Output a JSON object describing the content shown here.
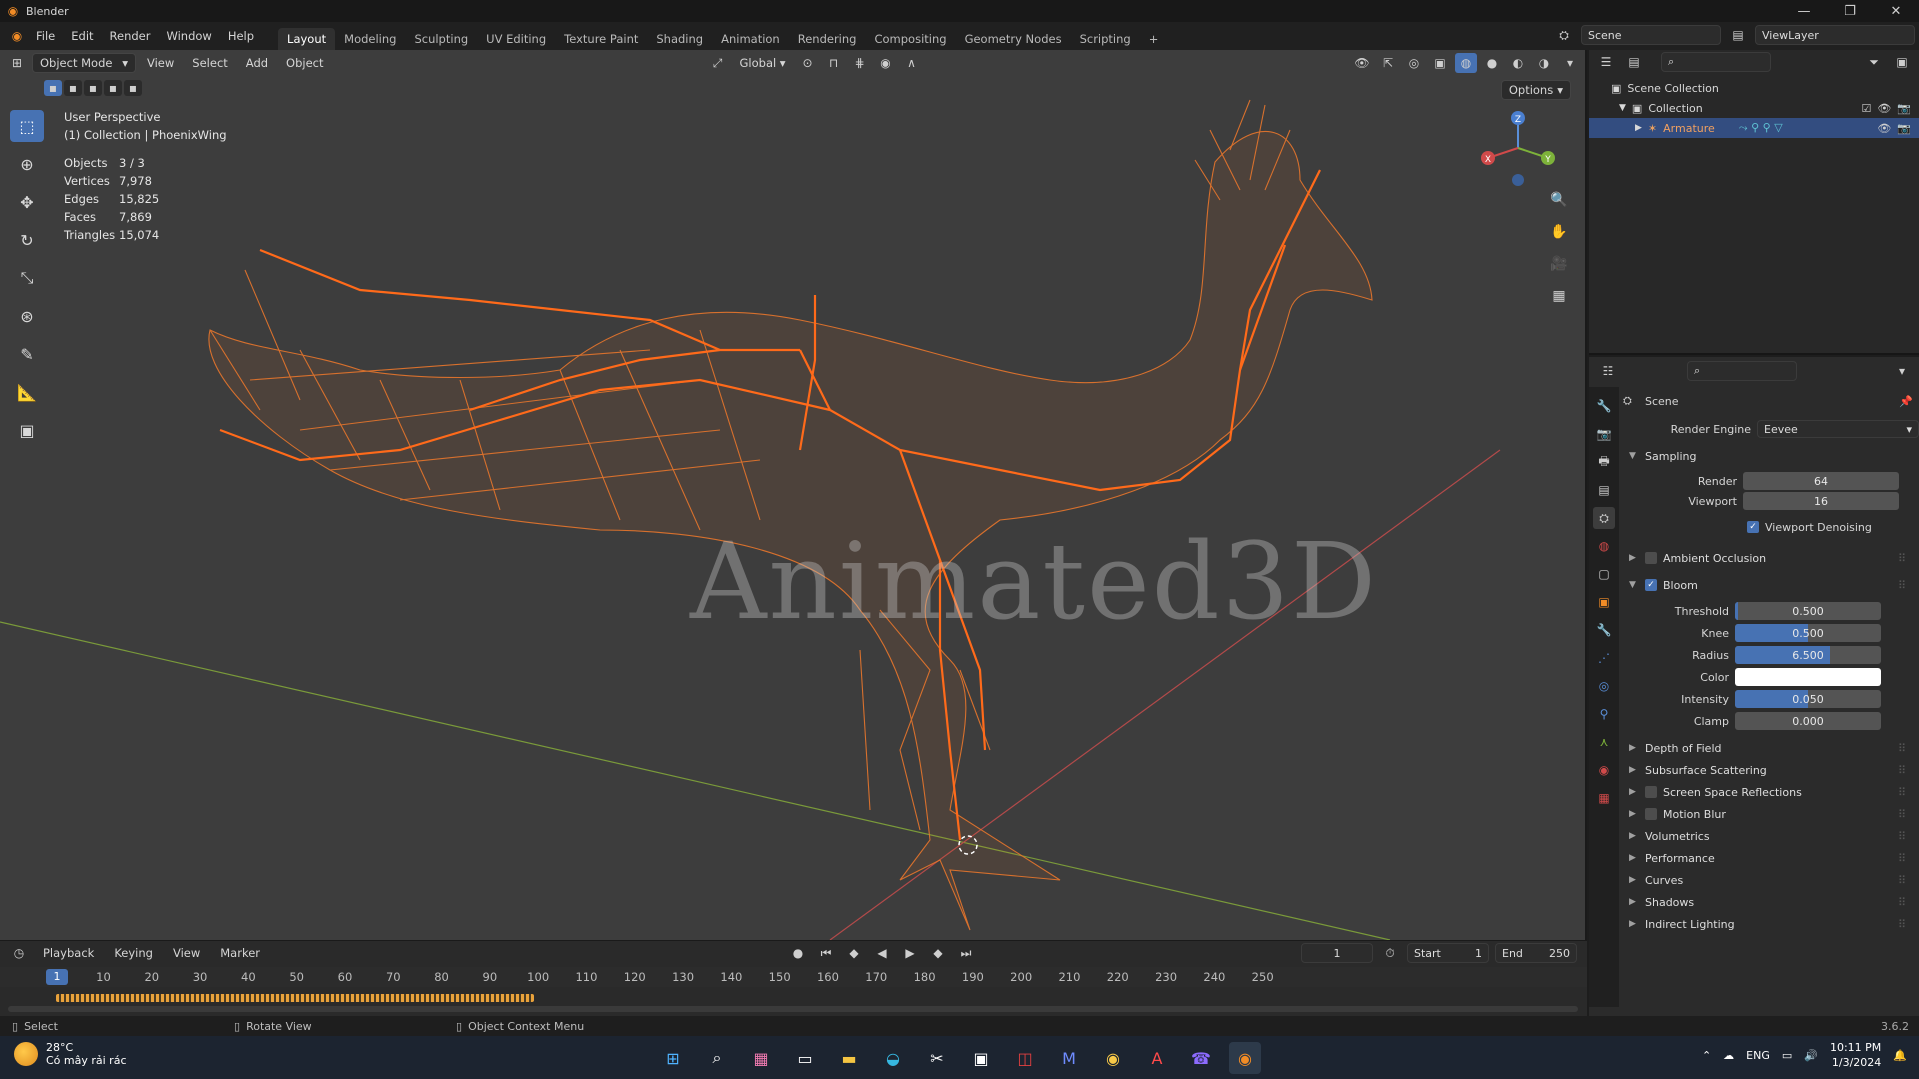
{
  "window": {
    "title": "Blender",
    "controls": [
      "—",
      "❐",
      "✕"
    ]
  },
  "menu": {
    "items": [
      "File",
      "Edit",
      "Render",
      "Window",
      "Help"
    ]
  },
  "workspaces": {
    "tabs": [
      "Layout",
      "Modeling",
      "Sculpting",
      "UV Editing",
      "Texture Paint",
      "Shading",
      "Animation",
      "Rendering",
      "Compositing",
      "Geometry Nodes",
      "Scripting"
    ],
    "active": "Layout",
    "add": "+"
  },
  "scene_selector": {
    "value": "Scene"
  },
  "viewlayer_selector": {
    "value": "ViewLayer"
  },
  "viewport_header": {
    "mode": "Object Mode",
    "menus": [
      "View",
      "Select",
      "Add",
      "Object"
    ],
    "transform_orientation": "Global",
    "options_label": "Options"
  },
  "viewport_overlay": {
    "perspective": "User Perspective",
    "collection": "(1) Collection | PhoenixWing"
  },
  "stats": [
    {
      "label": "Objects",
      "value": "3 / 3"
    },
    {
      "label": "Vertices",
      "value": "7,978"
    },
    {
      "label": "Edges",
      "value": "15,825"
    },
    {
      "label": "Faces",
      "value": "7,869"
    },
    {
      "label": "Triangles",
      "value": "15,074"
    }
  ],
  "gizmo": {
    "x": "X",
    "y": "Y",
    "z": "Z"
  },
  "watermark": "Animated3D",
  "timeline": {
    "menus": [
      "Playback",
      "Keying",
      "View",
      "Marker"
    ],
    "current_frame": "1",
    "start_label": "Start",
    "start": "1",
    "end_label": "End",
    "end": "250",
    "ticks": [
      "10",
      "20",
      "30",
      "40",
      "50",
      "60",
      "70",
      "80",
      "90",
      "100",
      "110",
      "120",
      "130",
      "140",
      "150",
      "160",
      "170",
      "180",
      "190",
      "200",
      "210",
      "220",
      "230",
      "240",
      "250"
    ]
  },
  "statusbar": {
    "items": [
      "Select",
      "Rotate View",
      "Object Context Menu"
    ],
    "version": "3.6.2"
  },
  "outliner": {
    "rows": [
      {
        "label": "Scene Collection"
      },
      {
        "label": "Collection"
      },
      {
        "label": "Armature"
      }
    ]
  },
  "properties": {
    "context": "Scene",
    "render_engine_label": "Render Engine",
    "render_engine": "Eevee",
    "sampling": {
      "title": "Sampling",
      "render_label": "Render",
      "render": "64",
      "viewport_label": "Viewport",
      "viewport": "16",
      "denoise_label": "Viewport Denoising",
      "denoise": true
    },
    "ambient_occlusion": {
      "title": "Ambient Occlusion",
      "enabled": false
    },
    "bloom": {
      "title": "Bloom",
      "enabled": true,
      "fields": [
        {
          "label": "Threshold",
          "value": "0.500",
          "fill": 0.02
        },
        {
          "label": "Knee",
          "value": "0.500",
          "fill": 0.5
        },
        {
          "label": "Radius",
          "value": "6.500",
          "fill": 0.65
        },
        {
          "label": "Intensity",
          "value": "0.050",
          "fill": 0.5
        },
        {
          "label": "Clamp",
          "value": "0.000",
          "fill": 0
        }
      ],
      "color_label": "Color",
      "color": "#ffffff"
    },
    "panels": [
      {
        "title": "Depth of Field",
        "checkbox": false
      },
      {
        "title": "Subsurface Scattering",
        "checkbox": false
      },
      {
        "title": "Screen Space Reflections",
        "checkbox": true
      },
      {
        "title": "Motion Blur",
        "checkbox": true
      },
      {
        "title": "Volumetrics",
        "checkbox": false
      },
      {
        "title": "Performance",
        "checkbox": false
      },
      {
        "title": "Curves",
        "checkbox": false
      },
      {
        "title": "Shadows",
        "checkbox": false
      },
      {
        "title": "Indirect Lighting",
        "checkbox": false
      }
    ]
  },
  "taskbar": {
    "temperature": "28°C",
    "weather": "Có mây rải rác",
    "language": "ENG",
    "time": "10:11 PM",
    "date": "1/3/2024"
  },
  "colors": {
    "accent": "#4772b3",
    "wire": "#e8762c",
    "bone": "#ff6a1a",
    "viewport_bg": "#3d3d3d"
  }
}
